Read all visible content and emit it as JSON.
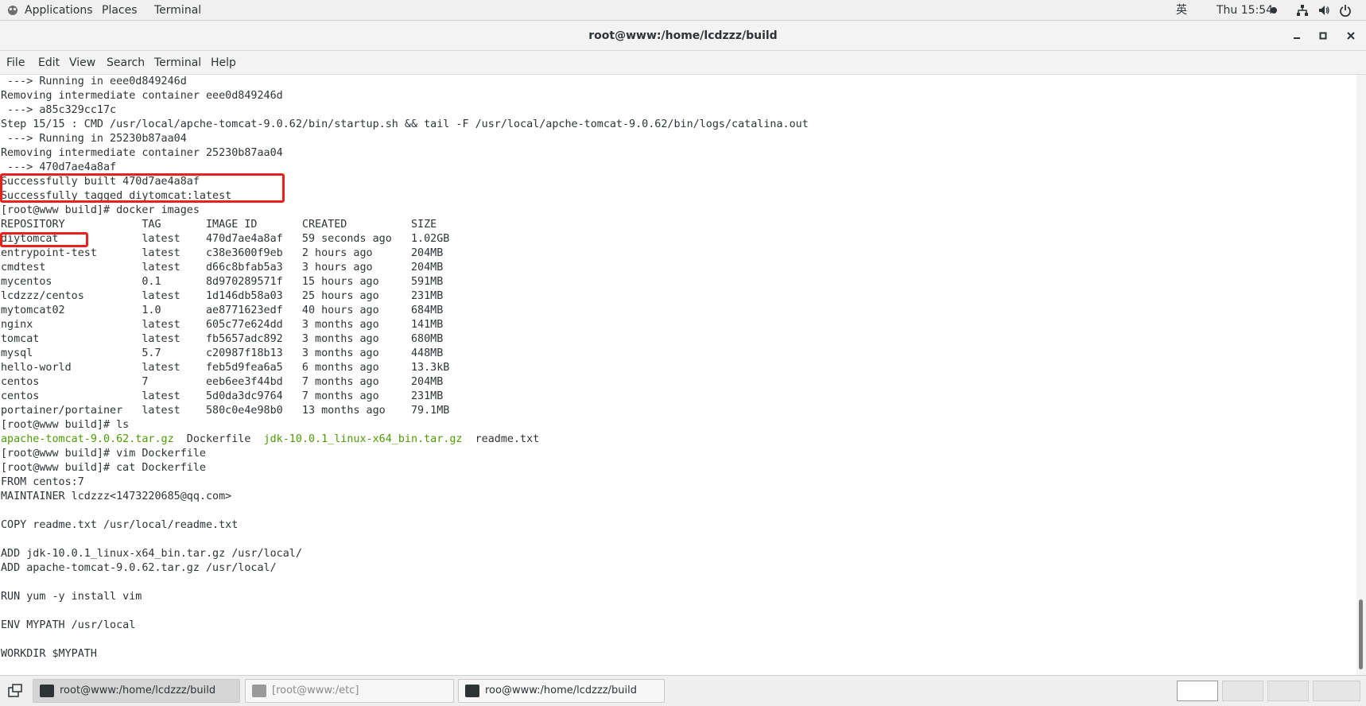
{
  "top_panel": {
    "applications": "Applications",
    "places": "Places",
    "terminal": "Terminal",
    "input_method": "英",
    "clock": "Thu 15:54",
    "icons": [
      "network-icon",
      "volume-icon",
      "power-icon"
    ]
  },
  "window": {
    "title": "root@www:/home/lcdzzz/build",
    "buttons": [
      "minimize",
      "maximize",
      "close"
    ]
  },
  "menu": {
    "file": "File",
    "edit": "Edit",
    "view": "View",
    "search": "Search",
    "terminal": "Terminal",
    "help": "Help"
  },
  "terminal": {
    "lines": [
      " ---> Running in eee0d849246d",
      "Removing intermediate container eee0d849246d",
      " ---> a85c329cc17c",
      "Step 15/15 : CMD /usr/local/apche-tomcat-9.0.62/bin/startup.sh && tail -F /usr/local/apche-tomcat-9.0.62/bin/logs/catalina.out",
      " ---> Running in 25230b87aa04",
      "Removing intermediate container 25230b87aa04",
      " ---> 470d7ae4a8af",
      "Successfully built 470d7ae4a8af",
      "Successfully tagged diytomcat:latest",
      "[root@www build]# docker images",
      "REPOSITORY            TAG       IMAGE ID       CREATED          SIZE",
      "diytomcat             latest    470d7ae4a8af   59 seconds ago   1.02GB",
      "entrypoint-test       latest    c38e3600f9eb   2 hours ago      204MB",
      "cmdtest               latest    d66c8bfab5a3   3 hours ago      204MB",
      "mycentos              0.1       8d970289571f   15 hours ago     591MB",
      "lcdzzz/centos         latest    1d146db58a03   25 hours ago     231MB",
      "mytomcat02            1.0       ae8771623edf   40 hours ago     684MB",
      "nginx                 latest    605c77e624dd   3 months ago     141MB",
      "tomcat                latest    fb5657adc892   3 months ago     680MB",
      "mysql                 5.7       c20987f18b13   3 months ago     448MB",
      "hello-world           latest    feb5d9fea6a5   6 months ago     13.3kB",
      "centos                7         eeb6ee3f44bd   7 months ago     204MB",
      "centos                latest    5d0da3dc9764   7 months ago     231MB",
      "portainer/portainer   latest    580c0e4e98b0   13 months ago    79.1MB",
      "[root@www build]# ls",
      "",
      "[root@www build]# vim Dockerfile",
      "[root@www build]# cat Dockerfile",
      "FROM centos:7",
      "MAINTAINER lcdzzz<1473220685@qq.com>",
      "",
      "COPY readme.txt /usr/local/readme.txt",
      "",
      "ADD jdk-10.0.1_linux-x64_bin.tar.gz /usr/local/",
      "ADD apache-tomcat-9.0.62.tar.gz /usr/local/",
      "",
      "RUN yum -y install vim",
      "",
      "ENV MYPATH /usr/local",
      "",
      "WORKDIR $MYPATH"
    ],
    "ls_output": {
      "file1": "apache-tomcat-9.0.62.tar.gz",
      "file2": "Dockerfile",
      "file3": "jdk-10.0.1_linux-x64_bin.tar.gz",
      "file4": "readme.txt"
    },
    "highlight_color": "#e8211d",
    "archive_color": "#4e9a06"
  },
  "taskbar": {
    "tasks": [
      {
        "label": "root@www:/home/lcdzzz/build",
        "state": "active"
      },
      {
        "label": "[root@www:/etc]",
        "state": "minimized"
      },
      {
        "label": "roo@www:/home/lcdzzz/build",
        "state": "normal"
      }
    ],
    "workspaces": 4
  }
}
